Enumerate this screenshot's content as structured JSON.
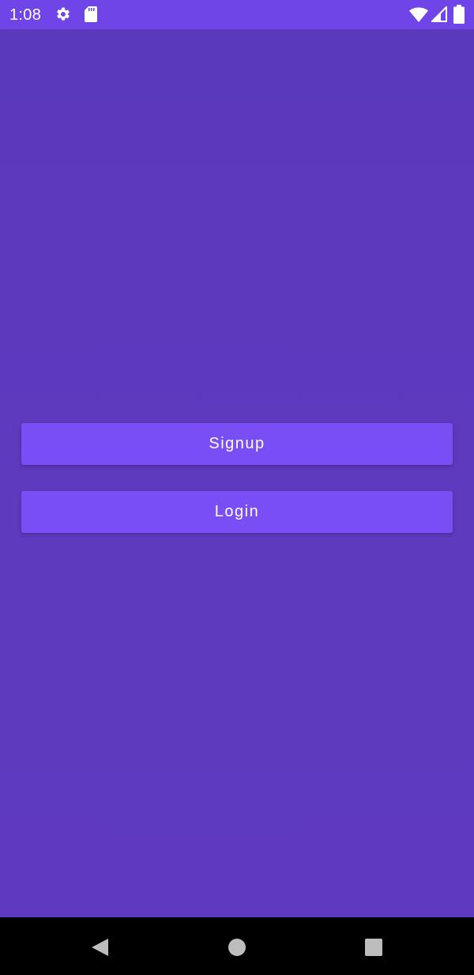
{
  "status_bar": {
    "time": "1:08",
    "icons": [
      "gear-icon",
      "sd-card-icon",
      "wifi-icon",
      "signal-icon",
      "battery-icon"
    ],
    "background_color": "#7045e8"
  },
  "main": {
    "background_color": "#5e3bbd",
    "buttons": {
      "signup_label": "Signup",
      "login_label": "Login"
    },
    "button_color": "#7a4ef5"
  },
  "nav_bar": {
    "icons": [
      "back-icon",
      "home-icon",
      "recents-icon"
    ]
  }
}
